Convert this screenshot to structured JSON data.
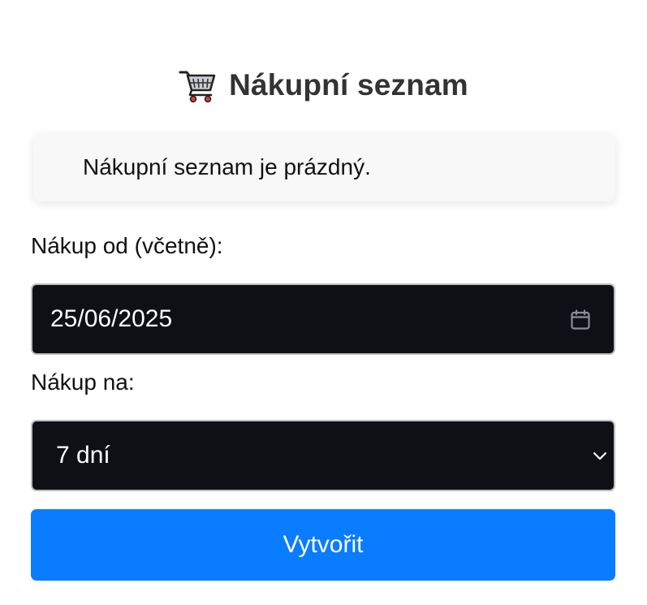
{
  "header": {
    "title": "Nákupní seznam",
    "icon": "shopping-cart-icon"
  },
  "list": {
    "empty_message": "Nákupní seznam je prázdný."
  },
  "form": {
    "date_label": "Nákup od (včetně):",
    "date_value": "25/06/2025",
    "date_icon": "calendar-icon",
    "duration_label": "Nákup na:",
    "duration_selected": "7 dní",
    "duration_icon": "chevron-down-icon",
    "submit_label": "Vytvořit"
  },
  "colors": {
    "accent": "#0a7cff",
    "input_background": "#0e1016",
    "title_text": "#333333",
    "empty_box_background": "#f8f8f8"
  }
}
